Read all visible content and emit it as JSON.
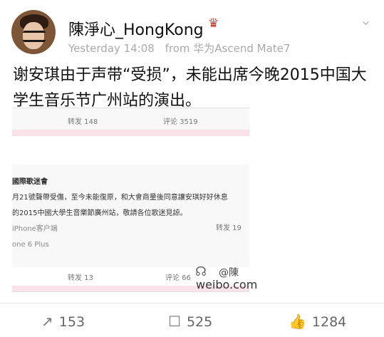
{
  "user": {
    "name": "陳淨心_HongKong",
    "badge": "heart-crown-icon"
  },
  "meta": {
    "time": "Yesterday 14:08",
    "source": "from 华为Ascend Mate7"
  },
  "post": {
    "text": "谢安琪由于声带“受损”，未能出席今晚2015中国大学生音乐节广州站的演出。"
  },
  "image": {
    "top_stats": {
      "repost": "转发 148",
      "comment": "评论 3519"
    },
    "title": "國際歌迷會",
    "lines": [
      "月21號聲帶受傷，至今未能復原，和大會商量後同意讓安琪好好休息",
      "的2015中國大學生音樂節廣州站，敬請各位歌迷見諒。"
    ],
    "client_1": "iPhone客户端",
    "right_stat_1": "转发 19",
    "client_2": "one 6 Plus",
    "bottom_stats": {
      "repost": "转发 13",
      "comment": "评论 66"
    },
    "watermark": {
      "at": "@陳",
      "url": "weibo.com"
    }
  },
  "actions": {
    "repost_count": "153",
    "comment_count": "525",
    "like_count": "1284"
  }
}
